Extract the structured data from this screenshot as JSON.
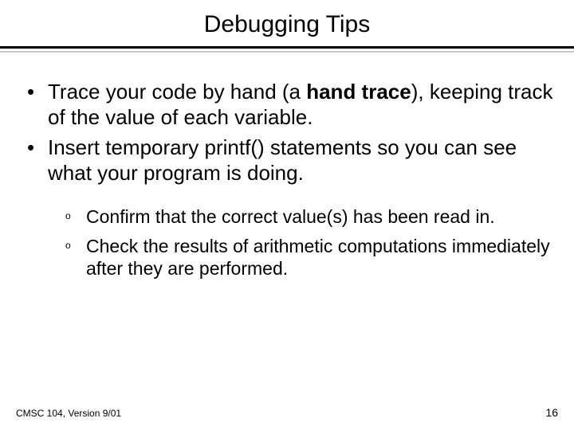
{
  "title": "Debugging Tips",
  "bullets": {
    "b1_pre": "Trace your code by hand (a ",
    "b1_bold": "hand trace",
    "b1_post": "), keeping track of the value of each variable.",
    "b2": "Insert temporary printf() statements so you can see what your program is doing."
  },
  "sub": {
    "marker": "o",
    "s1": "Confirm that the correct value(s) has been read in.",
    "s2": "Check the results of arithmetic computations immediately after they are performed."
  },
  "footer": {
    "left": "CMSC 104, Version 9/01",
    "right": "16"
  }
}
